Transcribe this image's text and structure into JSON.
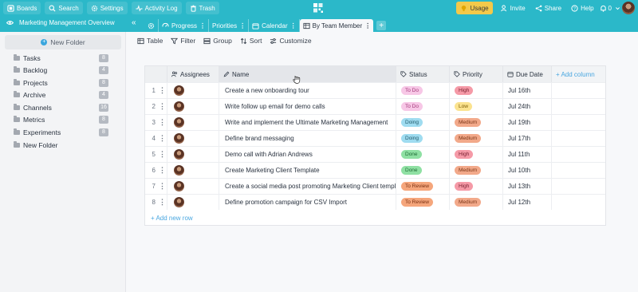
{
  "topbar": {
    "left_buttons": [
      {
        "icon": "boards-icon",
        "label": "Boards"
      },
      {
        "icon": "search-icon",
        "label": "Search"
      },
      {
        "icon": "gear-icon",
        "label": "Settings"
      },
      {
        "icon": "activity-icon",
        "label": "Activity Log"
      },
      {
        "icon": "trash-icon",
        "label": "Trash"
      }
    ],
    "right_buttons": [
      {
        "icon": "lightbulb-icon",
        "label": "Usage"
      },
      {
        "icon": "user-plus-icon",
        "label": "Invite"
      },
      {
        "icon": "share-icon",
        "label": "Share"
      },
      {
        "icon": "help-icon",
        "label": "Help"
      }
    ],
    "notification_count": "0"
  },
  "project": {
    "title": "Marketing Management Overview"
  },
  "tabs": [
    {
      "icon": "progress-icon",
      "label": "Progress",
      "active": false
    },
    {
      "icon": "priorities-icon",
      "label": "Priorities",
      "active": false
    },
    {
      "icon": "calendar-icon",
      "label": "Calendar",
      "active": false
    },
    {
      "icon": "table-icon",
      "label": "By Team Member",
      "active": true
    }
  ],
  "sidebar": {
    "new_folder_label": "New Folder",
    "folders": [
      {
        "label": "Tasks",
        "count": "8"
      },
      {
        "label": "Backlog",
        "count": "4"
      },
      {
        "label": "Projects",
        "count": "8"
      },
      {
        "label": "Archive",
        "count": "4"
      },
      {
        "label": "Channels",
        "count": "16"
      },
      {
        "label": "Metrics",
        "count": "8"
      },
      {
        "label": "Experiments",
        "count": "8"
      },
      {
        "label": "New Folder",
        "count": ""
      }
    ]
  },
  "toolbar": {
    "table": "Table",
    "filter": "Filter",
    "group": "Group",
    "sort": "Sort",
    "customize": "Customize"
  },
  "table": {
    "headers": {
      "assignees": "Assignees",
      "name": "Name",
      "status": "Status",
      "priority": "Priority",
      "due_date": "Due Date",
      "add_column": "+ Add column"
    },
    "rows": [
      {
        "num": "1",
        "name": "Create a new onboarding tour",
        "status": "To Do",
        "priority": "High",
        "due": "Jul 16th"
      },
      {
        "num": "2",
        "name": "Write follow up email for demo calls",
        "status": "To Do",
        "priority": "Low",
        "due": "Jul 24th"
      },
      {
        "num": "3",
        "name": "Write and implement the Ultimate Marketing Management",
        "status": "Doing",
        "priority": "Medium",
        "due": "Jul 19th"
      },
      {
        "num": "4",
        "name": "Define brand messaging",
        "status": "Doing",
        "priority": "Medium",
        "due": "Jul 17th"
      },
      {
        "num": "5",
        "name": "Demo call with Adrian Andrews",
        "status": "Done",
        "priority": "High",
        "due": "Jul 11th"
      },
      {
        "num": "6",
        "name": "Create Marketing Client Template",
        "status": "Done",
        "priority": "Medium",
        "due": "Jul 10th"
      },
      {
        "num": "7",
        "name": "Create a social media post promoting Marketing Client template",
        "status": "To Review",
        "priority": "High",
        "due": "Jul 13th"
      },
      {
        "num": "8",
        "name": "Define promotion campaign for CSV Import",
        "status": "To Review",
        "priority": "Medium",
        "due": "Jul 12th"
      }
    ],
    "new_row_label": "+ Add new row"
  },
  "colors": {
    "brand": "#2bb8c9",
    "status": {
      "To Do": "#f7c7e6",
      "Doing": "#9fdcf0",
      "Done": "#8fe0a3",
      "To Review": "#f5a67c"
    },
    "priority": {
      "High": "#f59aa7",
      "Low": "#fbe38f",
      "Medium": "#f2a98a"
    }
  }
}
